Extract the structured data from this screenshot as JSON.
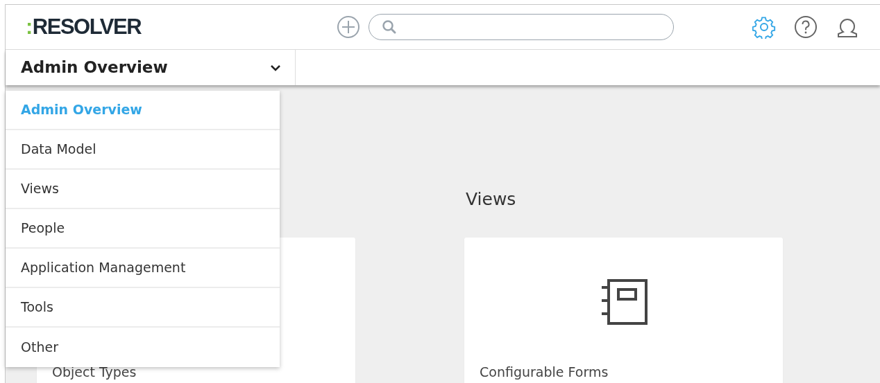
{
  "header": {
    "logo": {
      "mark": ":",
      "name": "RESOLVER"
    }
  },
  "nav": {
    "current": "Admin Overview",
    "menu_open": true
  },
  "menu": [
    {
      "label": "Admin Overview",
      "selected": true
    },
    {
      "label": "Data Model",
      "selected": false
    },
    {
      "label": "Views",
      "selected": false
    },
    {
      "label": "People",
      "selected": false
    },
    {
      "label": "Application Management",
      "selected": false
    },
    {
      "label": "Tools",
      "selected": false
    },
    {
      "label": "Other",
      "selected": false
    }
  ],
  "sections": [
    {
      "cards": [
        {
          "label": "Object Types"
        }
      ]
    },
    {
      "heading": "Views",
      "cards": [
        {
          "label": "Configurable Forms"
        }
      ]
    }
  ]
}
